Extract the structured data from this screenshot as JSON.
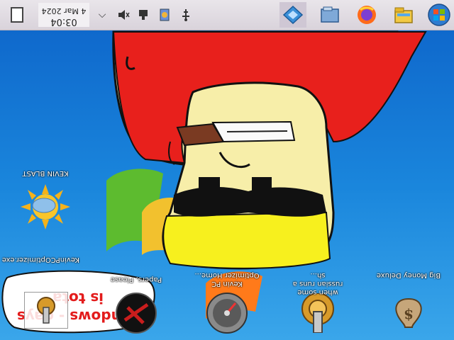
{
  "colors": {
    "taskbar": "#ddd7df",
    "desktop_top": "#0d63c9",
    "desktop_bottom": "#3aa6ea"
  },
  "taskbar": {
    "show_desktop_icon": "show-desktop-icon",
    "clock": {
      "time": "03:04",
      "date": "4 Mar 2024"
    },
    "tray_icons": [
      "chevron-up-icon",
      "speaker-muted-icon",
      "network-icon",
      "security-icon",
      "usb-icon"
    ],
    "pinned": [
      "ppsspp-icon",
      "file-explorer-icon",
      "firefox-icon",
      "folder-icon",
      "start-orb-icon"
    ]
  },
  "desktop_icons": [
    {
      "label": "Big Money Deluxe",
      "icon": "money-bag-icon"
    },
    {
      "label": "when some russian runs a sh...",
      "icon": "gear-icon"
    },
    {
      "label": "Kevin PC Optimizer Home...",
      "icon": "gauge-icon"
    },
    {
      "label": "Papers, Please",
      "icon": "papers-please-icon"
    },
    {
      "label": "KevinPCOptimizer.exe",
      "icon": "gear-small-icon"
    },
    {
      "label": "KEVIN BLAST",
      "icon": "weather-sun-icon"
    }
  ],
  "speech_bubble": {
    "lines": [
      "windows - gays",
      "is tota"
    ]
  }
}
